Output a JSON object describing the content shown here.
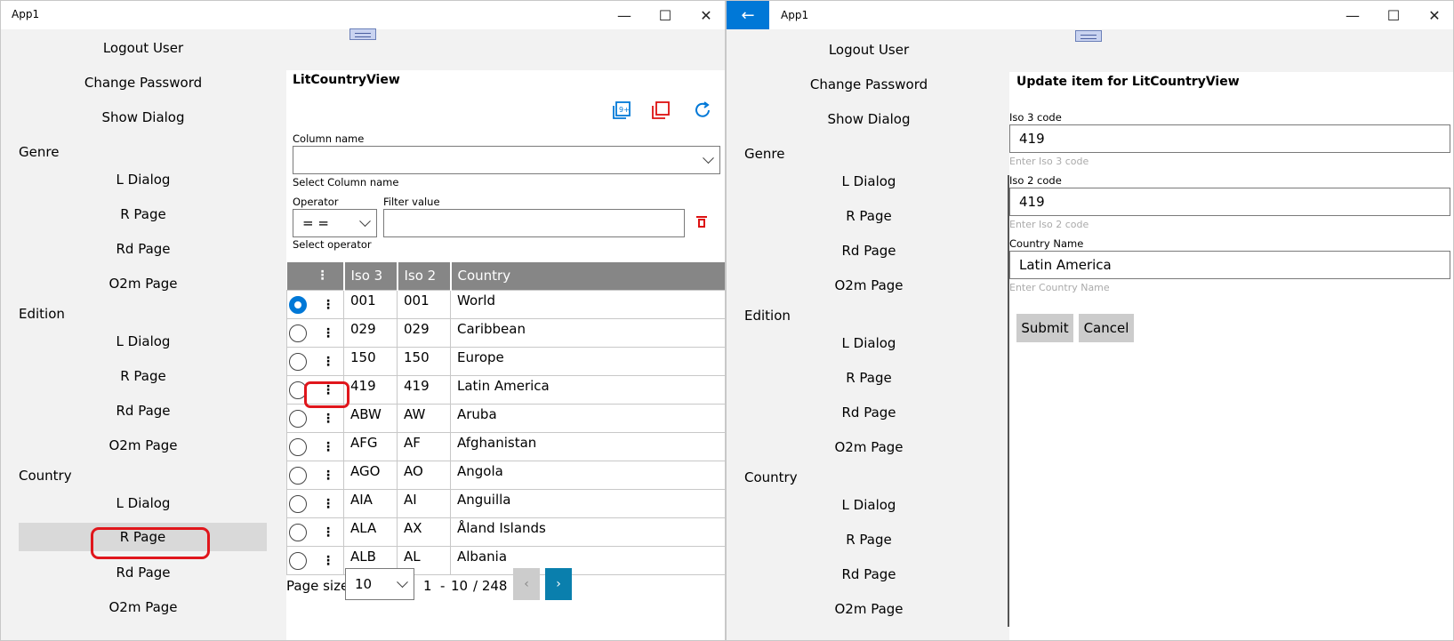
{
  "left_window": {
    "title": "App1",
    "caption": {
      "minimize": "—",
      "maximize": "☐",
      "close": "✕"
    },
    "nav": {
      "top_items": [
        "Logout User",
        "Change Password",
        "Show Dialog"
      ],
      "groups": [
        {
          "header": "Genre",
          "items": [
            "L Dialog",
            "R Page",
            "Rd Page",
            "O2m Page"
          ]
        },
        {
          "header": "Edition",
          "items": [
            "L Dialog",
            "R Page",
            "Rd Page",
            "O2m Page"
          ]
        },
        {
          "header": "Country",
          "items": [
            "L Dialog",
            "R Page",
            "Rd Page",
            "O2m Page"
          ],
          "selected": "R Page"
        }
      ]
    },
    "page": {
      "title": "LitCountryView",
      "toolbar": {
        "add_icon": "add-multiple-icon",
        "delete_icon": "delete-selected-icon",
        "refresh_icon": "refresh-icon"
      },
      "filter": {
        "column_label": "Column name",
        "column_value": "",
        "column_hint": "Select Column name",
        "operator_label": "Operator",
        "operator_value": "= =",
        "operator_hint": "Select operator",
        "value_label": "Filter value",
        "value": "",
        "clear_icon": "trash-icon"
      },
      "grid": {
        "headers": [
          "⋮",
          "Iso 3",
          "Iso 2",
          "Country"
        ],
        "rows": [
          {
            "iso3": "001",
            "iso2": "001",
            "country": "World",
            "selected": true
          },
          {
            "iso3": "029",
            "iso2": "029",
            "country": "Caribbean"
          },
          {
            "iso3": "150",
            "iso2": "150",
            "country": "Europe"
          },
          {
            "iso3": "419",
            "iso2": "419",
            "country": "Latin America"
          },
          {
            "iso3": "ABW",
            "iso2": "AW",
            "country": "Aruba"
          },
          {
            "iso3": "AFG",
            "iso2": "AF",
            "country": "Afghanistan"
          },
          {
            "iso3": "AGO",
            "iso2": "AO",
            "country": "Angola"
          },
          {
            "iso3": "AIA",
            "iso2": "AI",
            "country": "Anguilla"
          },
          {
            "iso3": "ALA",
            "iso2": "AX",
            "country": "Åland Islands"
          },
          {
            "iso3": "ALB",
            "iso2": "AL",
            "country": "Albania"
          }
        ]
      },
      "pager": {
        "size_label": "Page size",
        "size_value": "10",
        "from": "1",
        "dash": "-",
        "to": "10",
        "total": "/ 248",
        "prev": "‹",
        "next": "›"
      }
    }
  },
  "right_window": {
    "title": "App1",
    "back": "←",
    "caption": {
      "minimize": "—",
      "maximize": "☐",
      "close": "✕"
    },
    "nav": {
      "top_items": [
        "Logout User",
        "Change Password",
        "Show Dialog"
      ],
      "groups": [
        {
          "header": "Genre",
          "items": [
            "L Dialog",
            "R Page",
            "Rd Page",
            "O2m Page"
          ]
        },
        {
          "header": "Edition",
          "items": [
            "L Dialog",
            "R Page",
            "Rd Page",
            "O2m Page"
          ]
        },
        {
          "header": "Country",
          "items": [
            "L Dialog",
            "R Page",
            "Rd Page",
            "O2m Page"
          ]
        }
      ]
    },
    "form": {
      "title": "Update item for LitCountryView",
      "iso3": {
        "label": "Iso 3 code",
        "value": "419",
        "hint": "Enter Iso 3 code"
      },
      "iso2": {
        "label": "Iso 2 code",
        "value": "419",
        "hint": "Enter Iso 2 code"
      },
      "name": {
        "label": "Country Name",
        "value": "Latin America",
        "hint": "Enter Country Name"
      },
      "submit": "Submit",
      "cancel": "Cancel"
    }
  },
  "colors": {
    "accent": "#0078d7",
    "highlight": "#e0161c",
    "header_bg": "#868686",
    "toolbar_red": "#d11"
  }
}
